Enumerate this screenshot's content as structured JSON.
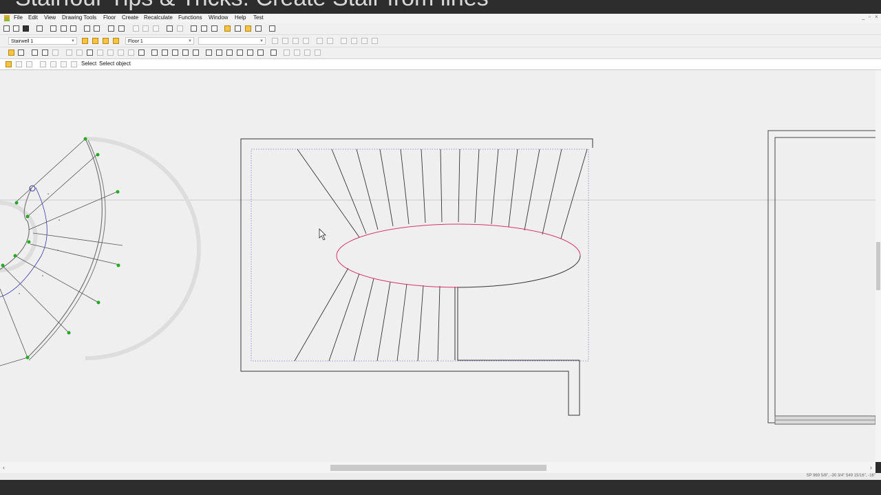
{
  "title": "Stairfour Tips & Tricks: Create Stair from lines",
  "menu": [
    "File",
    "Edit",
    "View",
    "Drawing Tools",
    "Floor",
    "Create",
    "Recalculate",
    "Functions",
    "Window",
    "Help",
    "Test"
  ],
  "window_controls": [
    "_",
    "▫",
    "×"
  ],
  "stairwell_select": "Stairwell 1",
  "floor_select": "Floor 1",
  "mode": "Select",
  "prompt": "Select object",
  "status_coords": "SP 969 5/8\", -30 3/4\"   549 15/16\", -16\"",
  "colors": {
    "selected_edge": "#d6336c",
    "node": "#22aa22",
    "guide": "#3333aa",
    "hidden_line": "#7777cc"
  }
}
